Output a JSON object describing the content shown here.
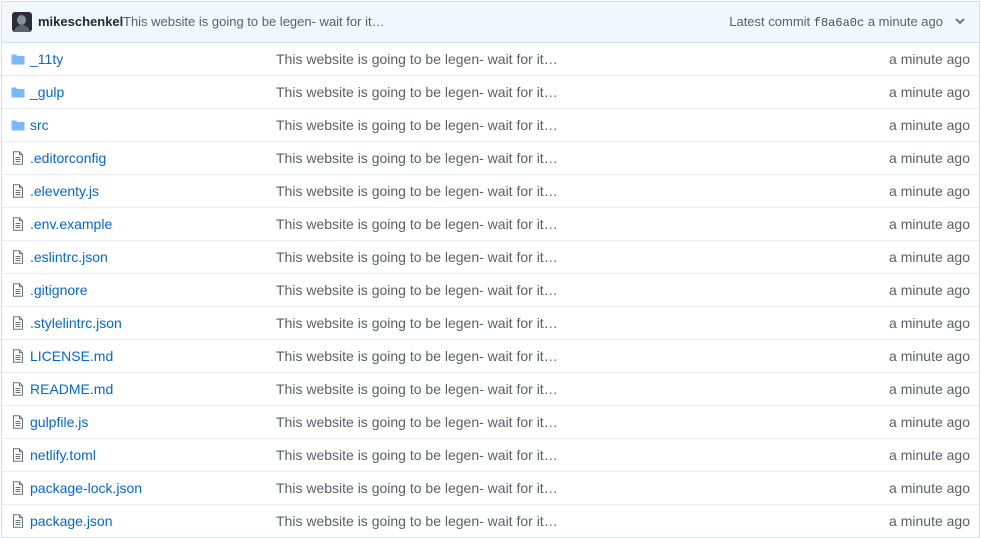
{
  "commit": {
    "author": "mikeschenkel",
    "message": "This website is going to be legen- wait for it…",
    "latest_label": "Latest commit",
    "sha": "f8a6a0c",
    "age": "a minute ago"
  },
  "files": [
    {
      "name": "_11ty",
      "type": "folder",
      "message": "This website is going to be legen- wait for it…",
      "age": "a minute ago"
    },
    {
      "name": "_gulp",
      "type": "folder",
      "message": "This website is going to be legen- wait for it…",
      "age": "a minute ago"
    },
    {
      "name": "src",
      "type": "folder",
      "message": "This website is going to be legen- wait for it…",
      "age": "a minute ago"
    },
    {
      "name": ".editorconfig",
      "type": "file",
      "message": "This website is going to be legen- wait for it…",
      "age": "a minute ago"
    },
    {
      "name": ".eleventy.js",
      "type": "file",
      "message": "This website is going to be legen- wait for it…",
      "age": "a minute ago"
    },
    {
      "name": ".env.example",
      "type": "file",
      "message": "This website is going to be legen- wait for it…",
      "age": "a minute ago"
    },
    {
      "name": ".eslintrc.json",
      "type": "file",
      "message": "This website is going to be legen- wait for it…",
      "age": "a minute ago"
    },
    {
      "name": ".gitignore",
      "type": "file",
      "message": "This website is going to be legen- wait for it…",
      "age": "a minute ago"
    },
    {
      "name": ".stylelintrc.json",
      "type": "file",
      "message": "This website is going to be legen- wait for it…",
      "age": "a minute ago"
    },
    {
      "name": "LICENSE.md",
      "type": "file",
      "message": "This website is going to be legen- wait for it…",
      "age": "a minute ago"
    },
    {
      "name": "README.md",
      "type": "file",
      "message": "This website is going to be legen- wait for it…",
      "age": "a minute ago"
    },
    {
      "name": "gulpfile.js",
      "type": "file",
      "message": "This website is going to be legen- wait for it…",
      "age": "a minute ago"
    },
    {
      "name": "netlify.toml",
      "type": "file",
      "message": "This website is going to be legen- wait for it…",
      "age": "a minute ago"
    },
    {
      "name": "package-lock.json",
      "type": "file",
      "message": "This website is going to be legen- wait for it…",
      "age": "a minute ago"
    },
    {
      "name": "package.json",
      "type": "file",
      "message": "This website is going to be legen- wait for it…",
      "age": "a minute ago"
    }
  ],
  "icons": {
    "folder": "folder-icon",
    "file": "file-icon",
    "expand": "chevron-down-icon",
    "avatar": "avatar"
  },
  "colors": {
    "link": "#0366d6",
    "folder_icon": "#79b8ff",
    "file_icon": "#6a737d",
    "commit_bar_bg": "#f1f8ff",
    "muted_text": "#586069"
  }
}
